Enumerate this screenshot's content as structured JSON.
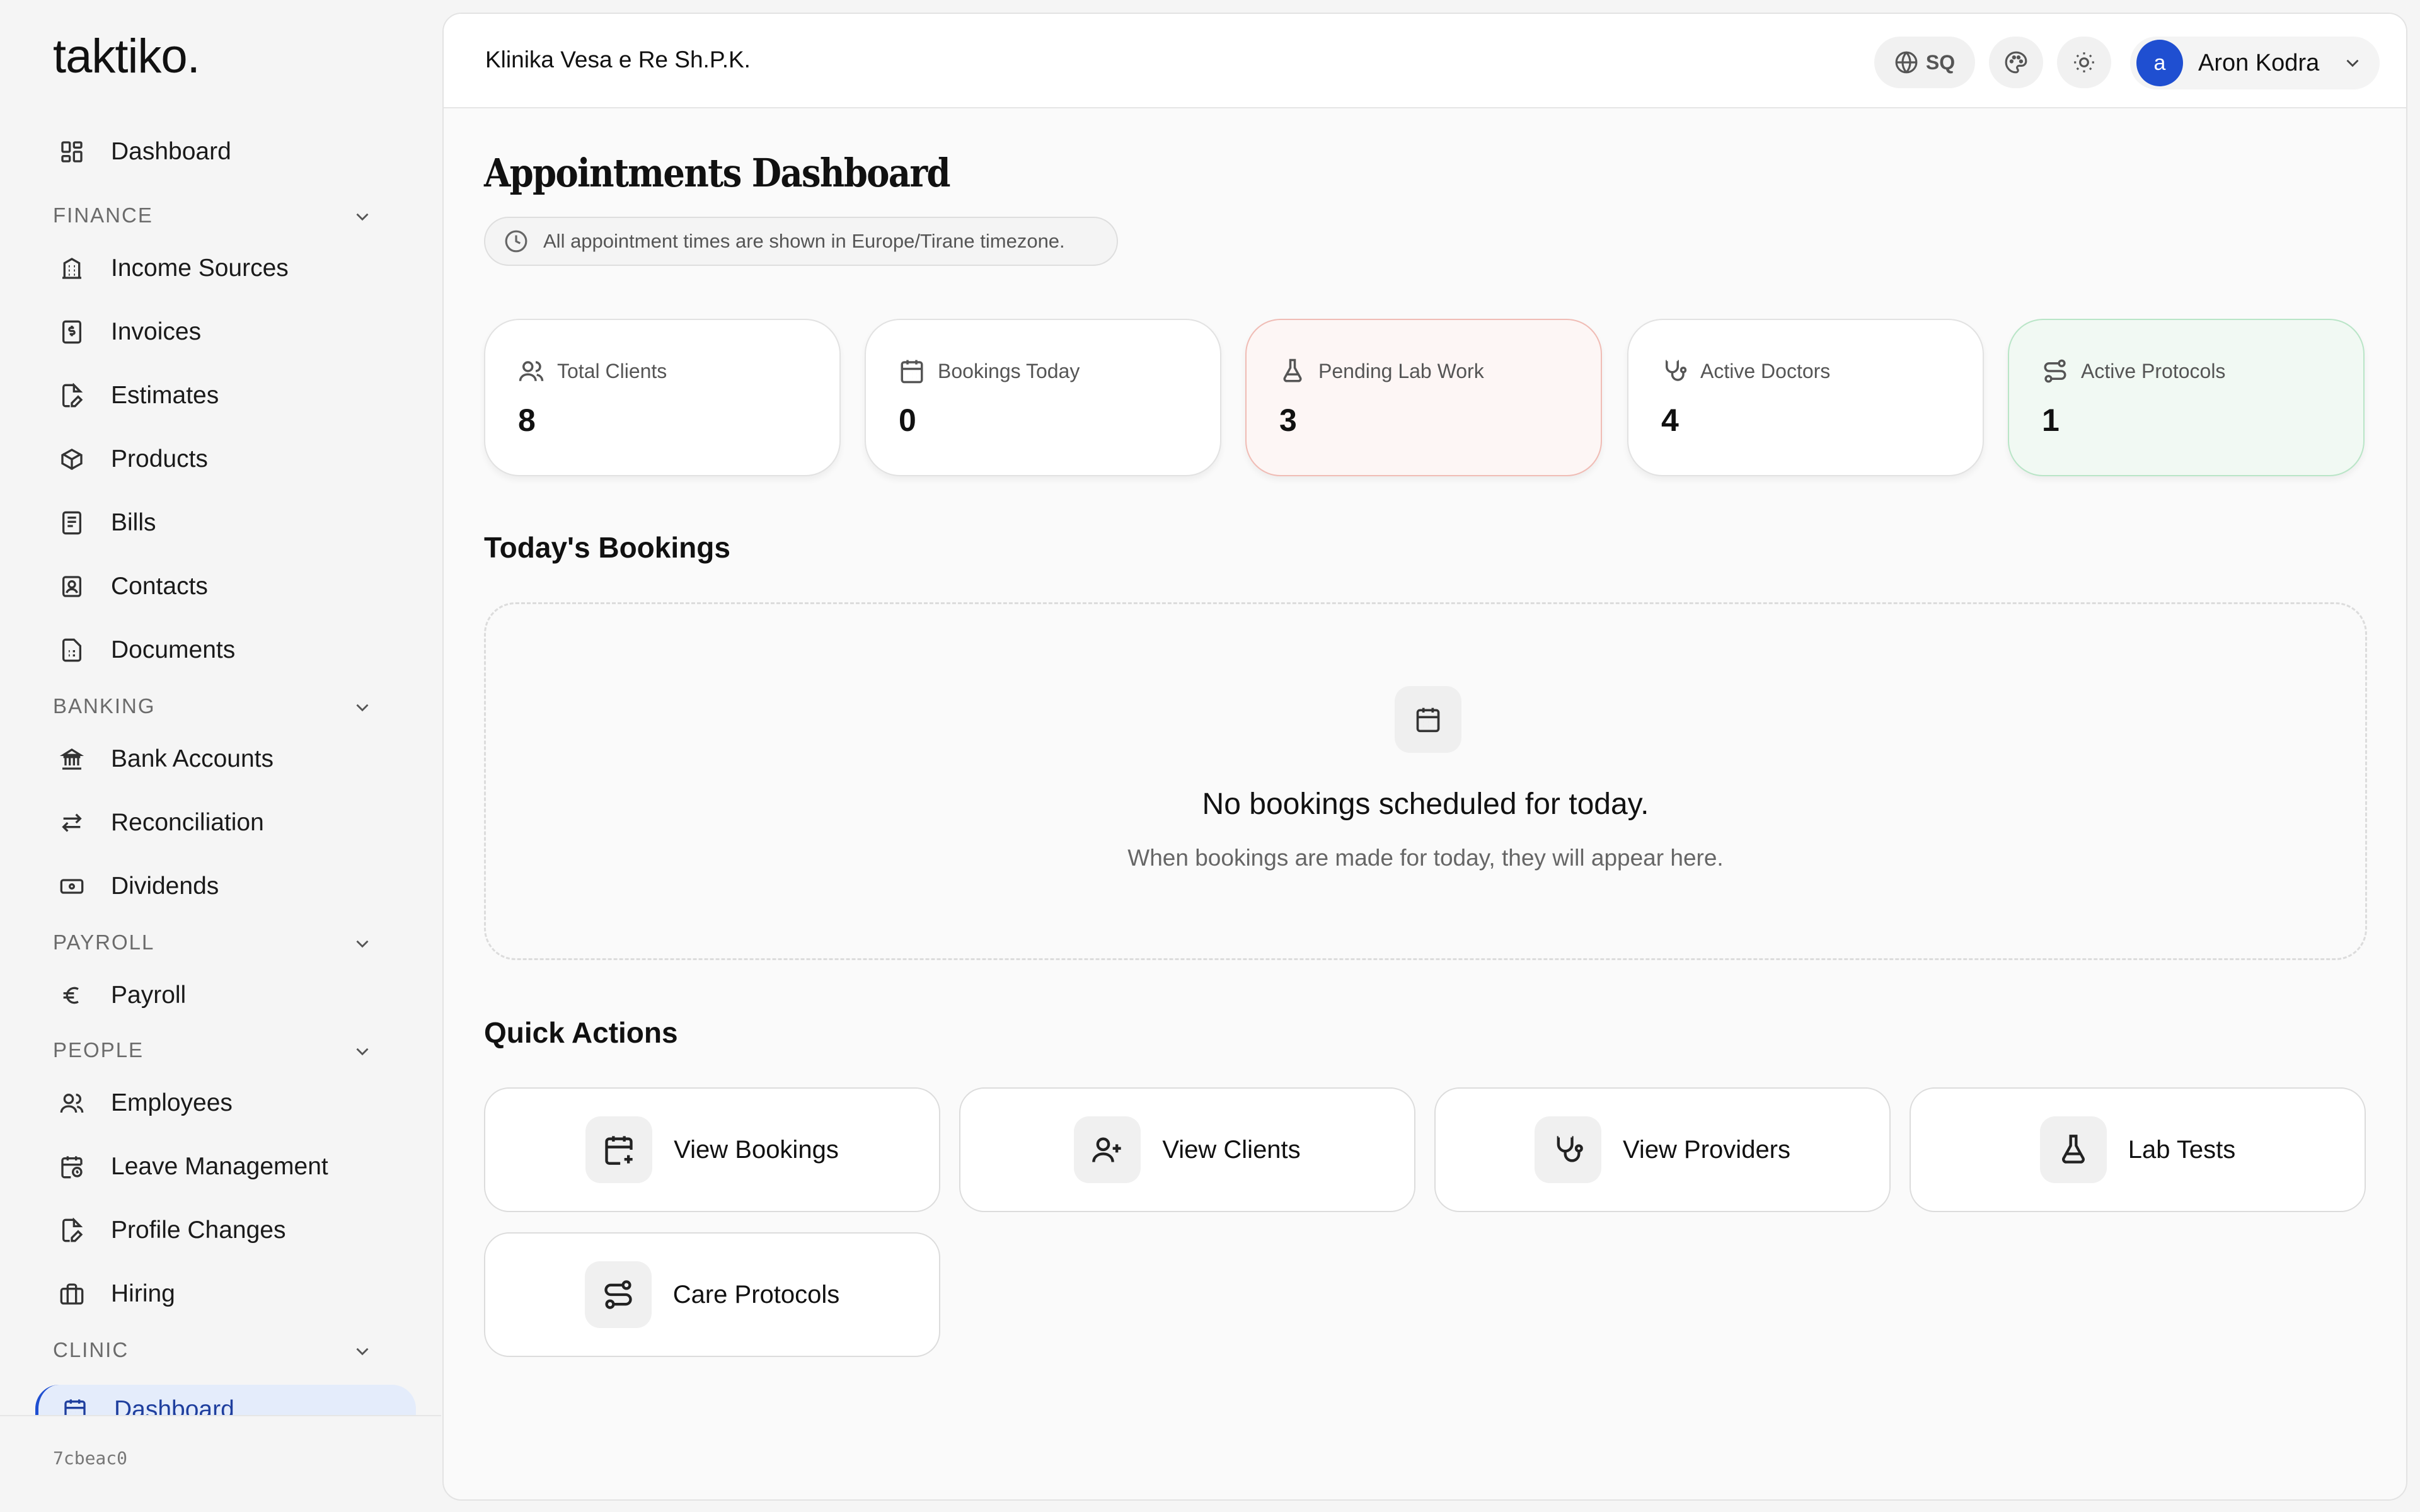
{
  "app": {
    "logo": "taktiko."
  },
  "sidebar": {
    "dashboard": "Dashboard",
    "sections": {
      "finance": "FINANCE",
      "banking": "BANKING",
      "payroll": "PAYROLL",
      "people": "PEOPLE",
      "clinic": "CLINIC"
    },
    "finance_items": [
      "Income Sources",
      "Invoices",
      "Estimates",
      "Products",
      "Bills",
      "Contacts",
      "Documents"
    ],
    "banking_items": [
      "Bank Accounts",
      "Reconciliation",
      "Dividends"
    ],
    "payroll_items": [
      "Payroll"
    ],
    "people_items": [
      "Employees",
      "Leave Management",
      "Profile Changes",
      "Hiring"
    ],
    "clinic_items": [
      "Dashboard"
    ],
    "version": "7cbeac0"
  },
  "header": {
    "org_name": "Klinika Vesa e Re Sh.P.K.",
    "language": "SQ",
    "user_initial": "a",
    "user_name": "Aron Kodra"
  },
  "page": {
    "title": "Appointments Dashboard",
    "timezone_note": "All appointment times are shown in Europe/Tirane timezone."
  },
  "stats": [
    {
      "label": "Total Clients",
      "value": "8"
    },
    {
      "label": "Bookings Today",
      "value": "0"
    },
    {
      "label": "Pending Lab Work",
      "value": "3"
    },
    {
      "label": "Active Doctors",
      "value": "4"
    },
    {
      "label": "Active Protocols",
      "value": "1"
    }
  ],
  "bookings": {
    "title": "Today's Bookings",
    "empty_title": "No bookings scheduled for today.",
    "empty_sub": "When bookings are made for today, they will appear here."
  },
  "quick_actions": {
    "title": "Quick Actions",
    "items": [
      "View Bookings",
      "View Clients",
      "View Providers",
      "Lab Tests",
      "Care Protocols"
    ]
  },
  "colors": {
    "accent": "#1f4fd1",
    "pending_bg": "#fdf6f5",
    "protocols_bg": "#f1f9f3"
  }
}
